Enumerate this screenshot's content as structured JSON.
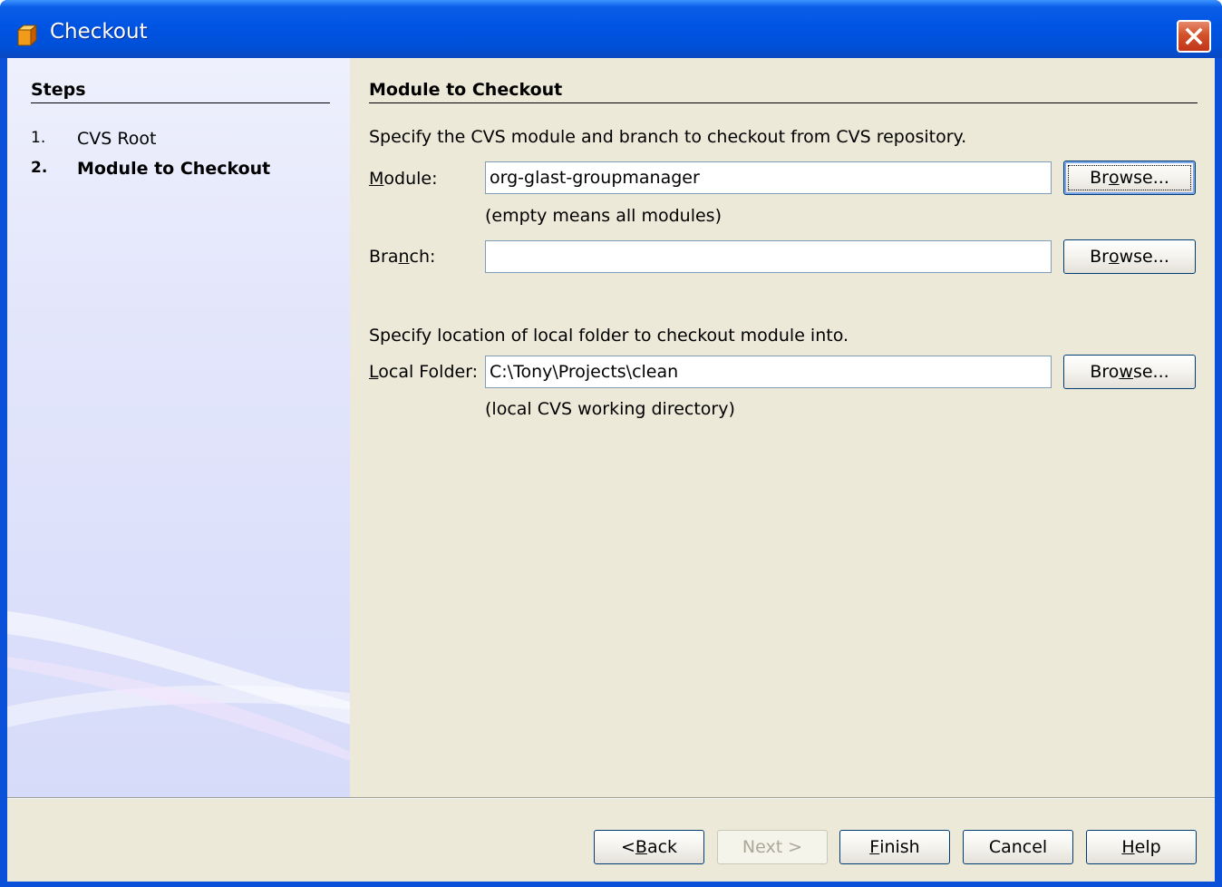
{
  "window": {
    "title": "Checkout"
  },
  "steps": {
    "title": "Steps",
    "items": [
      {
        "number": "1.",
        "label": "CVS Root",
        "current": false
      },
      {
        "number": "2.",
        "label": "Module to Checkout",
        "current": true
      }
    ]
  },
  "content": {
    "title": "Module to Checkout",
    "module_section_intro": "Specify the CVS module and branch to checkout from CVS repository.",
    "module": {
      "label_pre": "",
      "label_mnemonic": "M",
      "label_post": "odule:",
      "value": "org-glast-groupmanager",
      "hint": "(empty means all modules)",
      "browse_pre": "Br",
      "browse_mnemonic": "o",
      "browse_post": "wse..."
    },
    "branch": {
      "label_pre": "Bra",
      "label_mnemonic": "n",
      "label_post": "ch:",
      "value": "",
      "browse_pre": "Br",
      "browse_mnemonic": "o",
      "browse_post": "wse..."
    },
    "folder_section_intro": "Specify location of local folder to checkout module into.",
    "local_folder": {
      "label_pre": "",
      "label_mnemonic": "L",
      "label_post": "ocal Folder:",
      "value": "C:\\Tony\\Projects\\clean",
      "hint": "(local CVS working directory)",
      "browse_pre": "Bro",
      "browse_mnemonic": "w",
      "browse_post": "se..."
    }
  },
  "footer": {
    "back": {
      "pre": "< ",
      "mnemonic": "B",
      "post": "ack",
      "enabled": true
    },
    "next": {
      "label": "Next >",
      "enabled": false
    },
    "finish": {
      "pre": "",
      "mnemonic": "F",
      "post": "inish",
      "enabled": true
    },
    "cancel": {
      "label": "Cancel",
      "enabled": true
    },
    "help": {
      "pre": "",
      "mnemonic": "H",
      "post": "elp",
      "enabled": true
    }
  },
  "colors": {
    "titlebar": "#0054e3",
    "dialog_background": "#ece9d8",
    "steps_panel": "#dde1fa",
    "close_button": "#d2522b"
  }
}
